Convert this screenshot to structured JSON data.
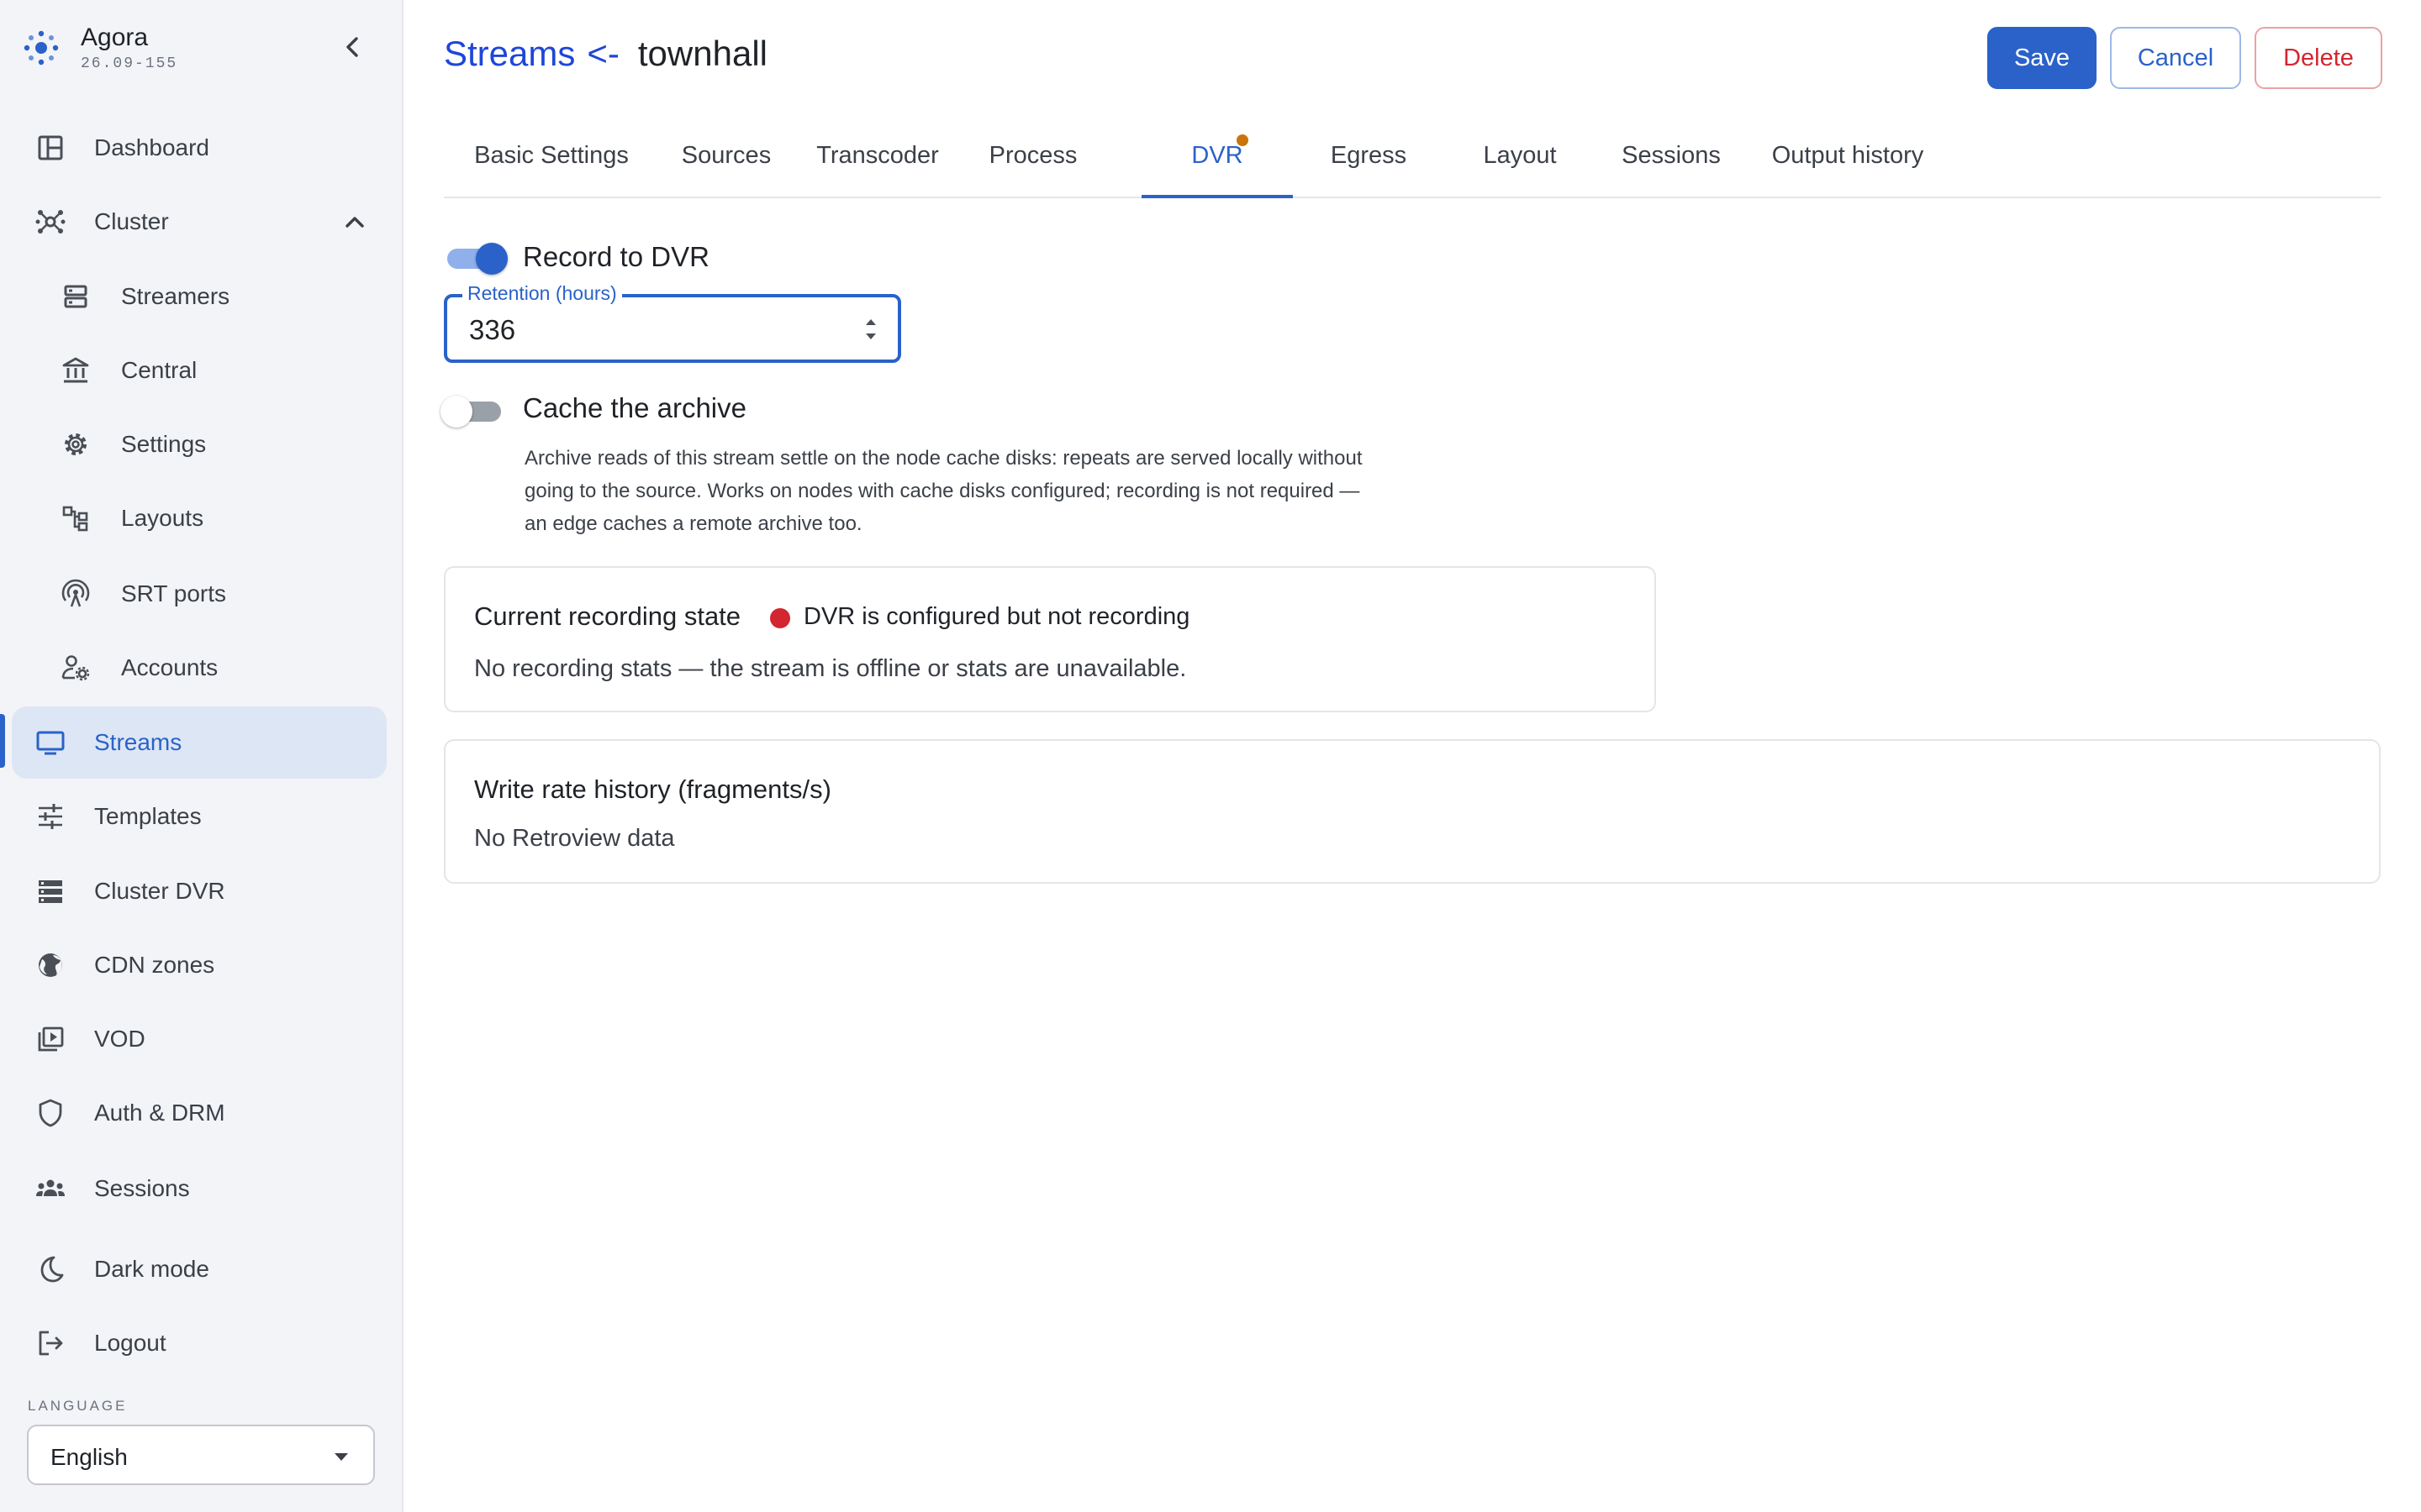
{
  "brand": {
    "name": "Agora",
    "version": "26.09-155",
    "logo_icon": "agora-logo-icon",
    "accent": "#2a62c9"
  },
  "sidebar": {
    "collapse_icon": "chevron-left-icon",
    "items": [
      {
        "label": "Dashboard",
        "icon": "dashboard-icon"
      },
      {
        "label": "Cluster",
        "icon": "cluster-icon",
        "expanded": true
      },
      {
        "label": "Streamers",
        "icon": "server-icon"
      },
      {
        "label": "Central",
        "icon": "bank-icon"
      },
      {
        "label": "Settings",
        "icon": "gear-icon"
      },
      {
        "label": "Layouts",
        "icon": "layouts-icon"
      },
      {
        "label": "SRT ports",
        "icon": "antenna-icon"
      },
      {
        "label": "Accounts",
        "icon": "user-gear-icon"
      },
      {
        "label": "Streams",
        "icon": "monitor-icon",
        "active": true
      },
      {
        "label": "Templates",
        "icon": "sliders-icon"
      },
      {
        "label": "Cluster DVR",
        "icon": "storage-icon"
      },
      {
        "label": "CDN zones",
        "icon": "globe-icon"
      },
      {
        "label": "VOD",
        "icon": "video-library-icon"
      },
      {
        "label": "Auth & DRM",
        "icon": "shield-icon"
      },
      {
        "label": "Sessions",
        "icon": "people-icon"
      },
      {
        "label": "Dark mode",
        "icon": "moon-icon"
      },
      {
        "label": "Logout",
        "icon": "logout-icon"
      }
    ],
    "language": {
      "label": "LANGUAGE",
      "value": "English"
    }
  },
  "header": {
    "breadcrumb_link": "Streams",
    "breadcrumb_separator": "<-",
    "stream_name": "townhall",
    "actions": {
      "save": "Save",
      "cancel": "Cancel",
      "delete": "Delete"
    }
  },
  "tabs": [
    {
      "label": "Basic Settings"
    },
    {
      "label": "Sources"
    },
    {
      "label": "Transcoder"
    },
    {
      "label": "Process"
    },
    {
      "label": "DVR",
      "active": true,
      "has_changes": true
    },
    {
      "label": "Egress"
    },
    {
      "label": "Layout"
    },
    {
      "label": "Sessions"
    },
    {
      "label": "Output history"
    }
  ],
  "dvr": {
    "record": {
      "label": "Record to DVR",
      "enabled": true
    },
    "retention": {
      "label": "Retention (hours)",
      "value": "336"
    },
    "cache": {
      "label": "Cache the archive",
      "enabled": false,
      "help": "Archive reads of this stream settle on the node cache disks: repeats are served locally without going to the source. Works on nodes with cache disks configured; recording is not required — an edge caches a remote archive too."
    },
    "recording_state": {
      "title": "Current recording state",
      "status": "DVR is configured but not recording",
      "status_color": "#d3262f",
      "message": "No recording stats — the stream is offline or stats are unavailable."
    },
    "write_rate": {
      "title": "Write rate history (fragments/s)",
      "message": "No Retroview data"
    }
  }
}
